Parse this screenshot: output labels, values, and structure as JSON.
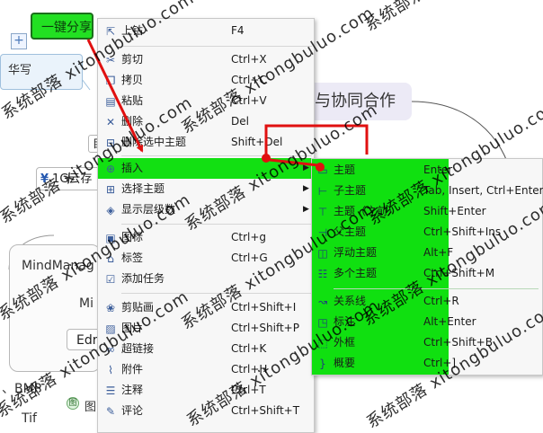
{
  "background": {
    "top_node": "一键分享",
    "plus_icon": "+",
    "callout": "华写",
    "main_topic": "与协同合作",
    "left_chip": "目",
    "currency_node": "1G云存",
    "mindmanager_label": "MindManag",
    "mi_label": "Mi",
    "edr_label": "Edr",
    "bmp_label": "、BMP",
    "tif_label": "Tif",
    "small_circle": "图",
    "small_label": "图"
  },
  "menu": {
    "items": [
      {
        "label": "上钻",
        "shortcut": "F4",
        "icon": "drill-up-icon"
      },
      {
        "label": "剪切",
        "shortcut": "Ctrl+X",
        "icon": "cut-icon"
      },
      {
        "label": "拷贝",
        "shortcut": "Ctrl+C",
        "icon": "copy-icon"
      },
      {
        "label": "粘贴",
        "shortcut": "Ctrl+V",
        "icon": "paste-icon"
      },
      {
        "label": "删除",
        "shortcut": "Del",
        "icon": "delete-icon"
      },
      {
        "label": "删除选中主题",
        "shortcut": "Shift+Del",
        "icon": "delete-topic-icon"
      },
      {
        "label": "插入",
        "shortcut": "",
        "icon": "insert-icon"
      },
      {
        "label": "选择主题",
        "shortcut": "",
        "icon": "select-topic-icon"
      },
      {
        "label": "显示层级数",
        "shortcut": "",
        "icon": "levels-icon"
      },
      {
        "label": "图标",
        "shortcut": "Ctrl+g",
        "icon": "image-icon"
      },
      {
        "label": "标签",
        "shortcut": "Ctrl+G",
        "icon": "tag-icon"
      },
      {
        "label": "添加任务",
        "shortcut": "",
        "icon": "task-icon"
      },
      {
        "label": "剪贴画",
        "shortcut": "Ctrl+Shift+I",
        "icon": "clipart-icon"
      },
      {
        "label": "图片",
        "shortcut": "Ctrl+Shift+P",
        "icon": "picture-icon"
      },
      {
        "label": "超链接",
        "shortcut": "Ctrl+K",
        "icon": "link-icon"
      },
      {
        "label": "附件",
        "shortcut": "Ctrl+H",
        "icon": "attachment-icon"
      },
      {
        "label": "注释",
        "shortcut": "Ctrl+T",
        "icon": "note-icon"
      },
      {
        "label": "评论",
        "shortcut": "Ctrl+Shift+T",
        "icon": "comment-icon"
      }
    ]
  },
  "submenu": {
    "items": [
      {
        "label": "主题",
        "shortcut": "Enter",
        "icon": "topic-icon"
      },
      {
        "label": "子主题",
        "shortcut": "Tab, Insert, Ctrl+Enter",
        "icon": "subtopic-icon"
      },
      {
        "label": "主题（之前）",
        "shortcut": "Shift+Enter",
        "icon": "topic-before-icon"
      },
      {
        "label": "父主题",
        "shortcut": "Ctrl+Shift+Ins",
        "icon": "parent-topic-icon"
      },
      {
        "label": "浮动主题",
        "shortcut": "Alt+F",
        "icon": "floating-topic-icon"
      },
      {
        "label": "多个主题",
        "shortcut": "Ctrl+Shift+M",
        "icon": "multiple-topics-icon"
      },
      {
        "label": "关系线",
        "shortcut": "Ctrl+R",
        "icon": "relationship-icon"
      },
      {
        "label": "标注",
        "shortcut": "Alt+Enter",
        "icon": "callout-icon"
      },
      {
        "label": "外框",
        "shortcut": "Ctrl+Shift+B",
        "icon": "boundary-icon"
      },
      {
        "label": "概要",
        "shortcut": "Ctrl+]",
        "icon": "summary-icon"
      }
    ]
  },
  "colors": {
    "highlight": "#12e012",
    "annotation": "#e01010",
    "node_fill": "#22e022"
  },
  "watermark": {
    "text_cn": "系统部落",
    "text_url": "xitongbuluo.com"
  }
}
